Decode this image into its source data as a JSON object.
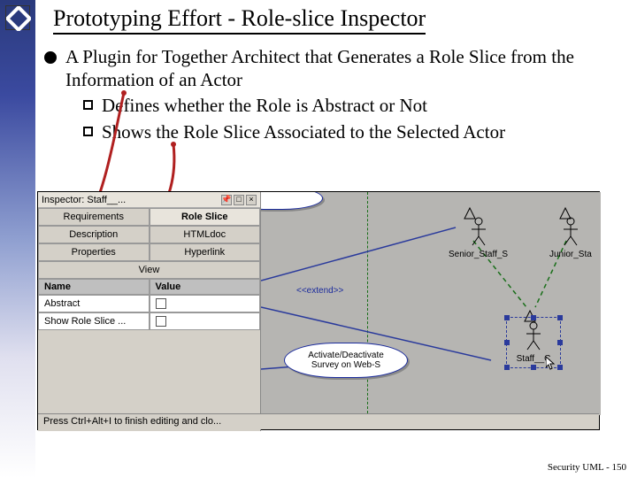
{
  "title": "Prototyping Effort - Role-slice Inspector",
  "bullets": {
    "main": "A Plugin for Together Architect that Generates a Role Slice from the Information of an Actor",
    "sub1": "Defines whether the Role is Abstract or Not",
    "sub2": "Shows the Role Slice Associated to the Selected Actor"
  },
  "inspector": {
    "header": "Inspector: Staff__...",
    "tabs": {
      "requirements": "Requirements",
      "roleslice": "Role Slice",
      "description": "Description",
      "htmldoc": "HTMLdoc",
      "properties": "Properties",
      "hyperlink": "Hyperlink",
      "view": "View"
    },
    "nameHdr": "Name",
    "valueHdr": "Value",
    "rows": {
      "abstract": "Abstract",
      "showrs": "Show Role Slice ..."
    }
  },
  "canvas": {
    "actor1": "Senior_Staff_S",
    "actor2": "Junior_Sta",
    "actor3": "Staff__C",
    "stereo": "<<extend>>",
    "usecase": "Activate/Deactivate Survey on Web-S"
  },
  "statusbar": "Press Ctrl+Alt+I to finish editing and clo...",
  "footer": "Security UML - 150"
}
